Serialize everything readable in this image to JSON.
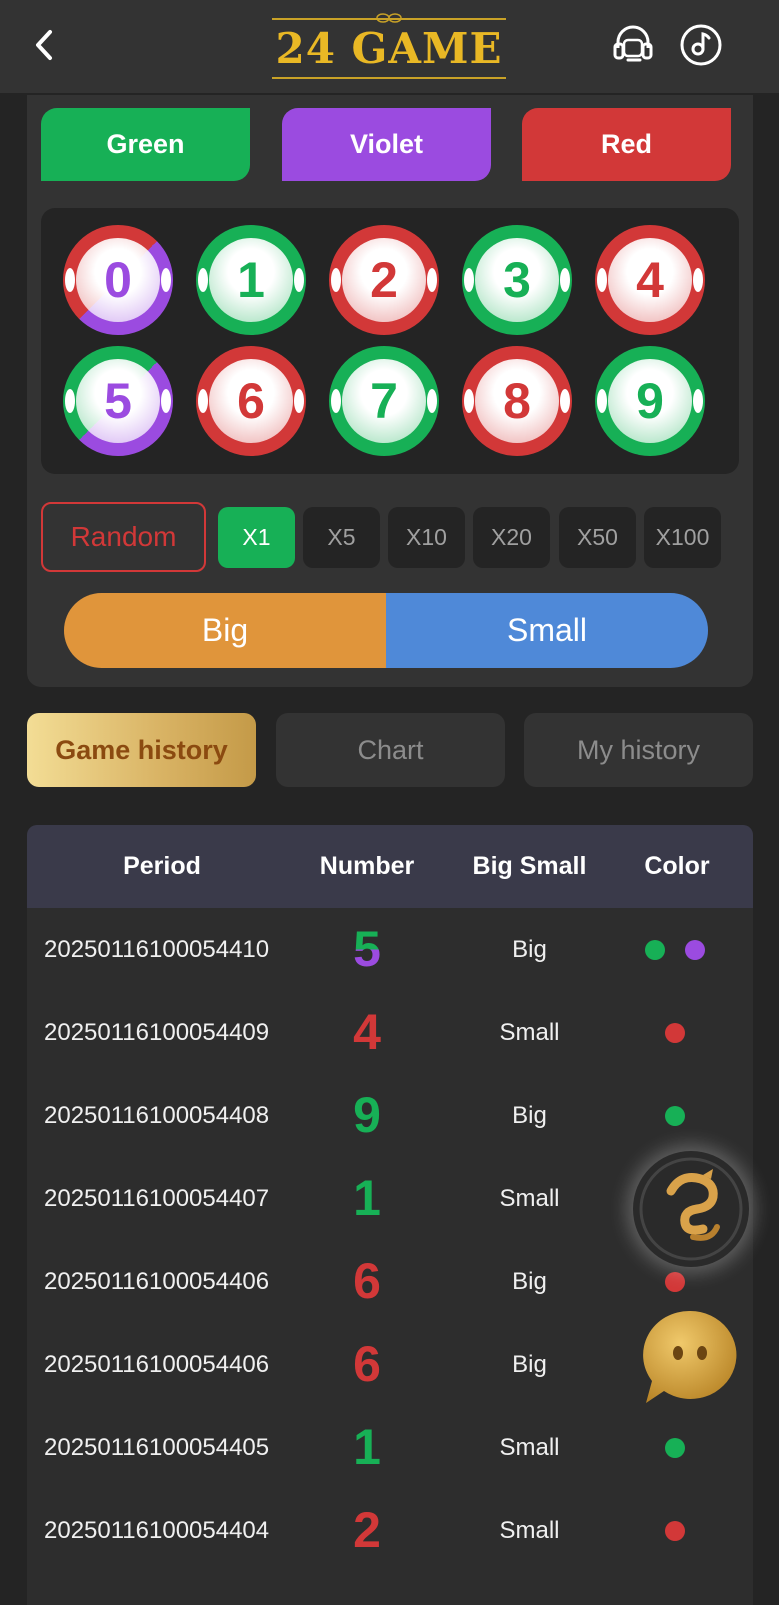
{
  "header": {
    "logo_text": "24 GAME",
    "back_icon": "chevron-left-icon",
    "support_icon": "headset-icon",
    "sound_icon": "music-note-icon"
  },
  "colors": {
    "green": "#17b056",
    "violet": "#9b4be0",
    "red": "#d23838",
    "big": "#e0953b",
    "small": "#4f89d8",
    "gold": "#e9b825"
  },
  "color_buttons": {
    "green": "Green",
    "violet": "Violet",
    "red": "Red"
  },
  "numbers": [
    "0",
    "1",
    "2",
    "3",
    "4",
    "5",
    "6",
    "7",
    "8",
    "9"
  ],
  "random_label": "Random",
  "multipliers": [
    "X1",
    "X5",
    "X10",
    "X20",
    "X50",
    "X100"
  ],
  "active_multiplier": "X1",
  "big_label": "Big",
  "small_label": "Small",
  "tabs": {
    "game_history": "Game history",
    "chart": "Chart",
    "my_history": "My history"
  },
  "table": {
    "headers": {
      "period": "Period",
      "number": "Number",
      "big_small": "Big Small",
      "color": "Color"
    },
    "rows": [
      {
        "period": "20250116100054410",
        "number": "5",
        "big_small": "Big",
        "colors": [
          "green",
          "violet"
        ]
      },
      {
        "period": "20250116100054409",
        "number": "4",
        "big_small": "Small",
        "colors": [
          "red"
        ]
      },
      {
        "period": "20250116100054408",
        "number": "9",
        "big_small": "Big",
        "colors": [
          "green"
        ]
      },
      {
        "period": "20250116100054407",
        "number": "1",
        "big_small": "Small",
        "colors": [
          "green"
        ]
      },
      {
        "period": "20250116100054406",
        "number": "6",
        "big_small": "Big",
        "colors": [
          "red"
        ]
      },
      {
        "period": "20250116100054406",
        "number": "6",
        "big_small": "Big",
        "colors": [
          "red"
        ]
      },
      {
        "period": "20250116100054405",
        "number": "1",
        "big_small": "Small",
        "colors": [
          "green"
        ]
      },
      {
        "period": "20250116100054404",
        "number": "2",
        "big_small": "Small",
        "colors": [
          "red"
        ]
      }
    ]
  },
  "floating": {
    "dragon_icon": "dragon-icon",
    "chat_icon": "chat-bubble-icon"
  }
}
